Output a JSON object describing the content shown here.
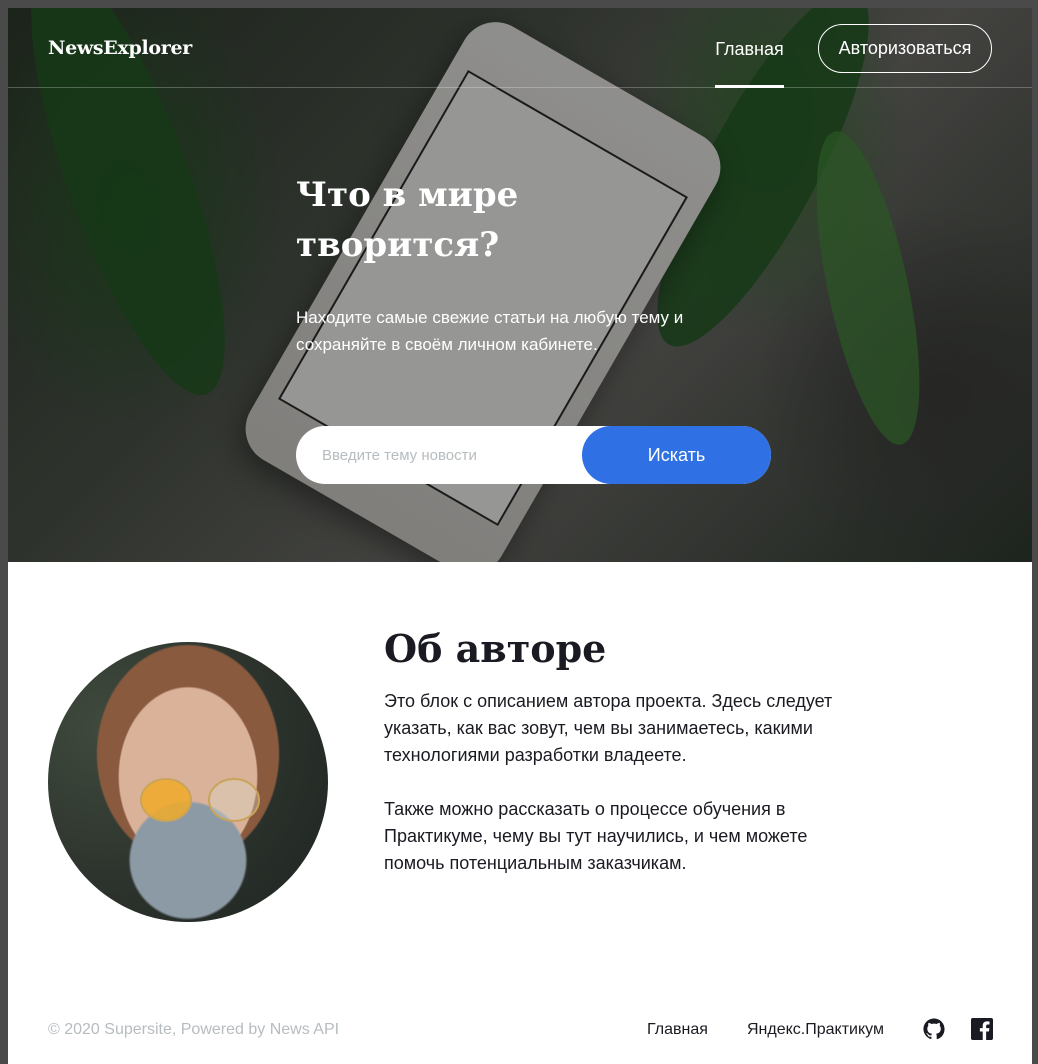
{
  "header": {
    "logo": "NewsExplorer",
    "nav_home": "Главная",
    "auth_button": "Авторизоваться"
  },
  "hero": {
    "title": "Что в мире творится?",
    "subtitle": "Находите самые свежие статьи на любую тему и сохраняйте в своём личном кабинете.",
    "search_placeholder": "Введите тему новости",
    "search_button": "Искать"
  },
  "about": {
    "title": "Об авторе",
    "paragraph_1": "Это блок с описанием автора проекта. Здесь следует указать, как вас зовут, чем вы занимаетесь, какими технологиями разработки владеете.",
    "paragraph_2": "Также можно рассказать о процессе обучения в Практикуме, чему вы тут научились, и чем можете помочь потенциальным заказчикам."
  },
  "footer": {
    "copyright": "© 2020 Supersite, Powered by News API",
    "links": [
      "Главная",
      "Яндекс.Практикум"
    ],
    "icons": [
      "github-icon",
      "facebook-icon"
    ]
  },
  "colors": {
    "accent": "#2f71e5",
    "text": "#1a1b22",
    "muted": "#b6bcbf"
  }
}
